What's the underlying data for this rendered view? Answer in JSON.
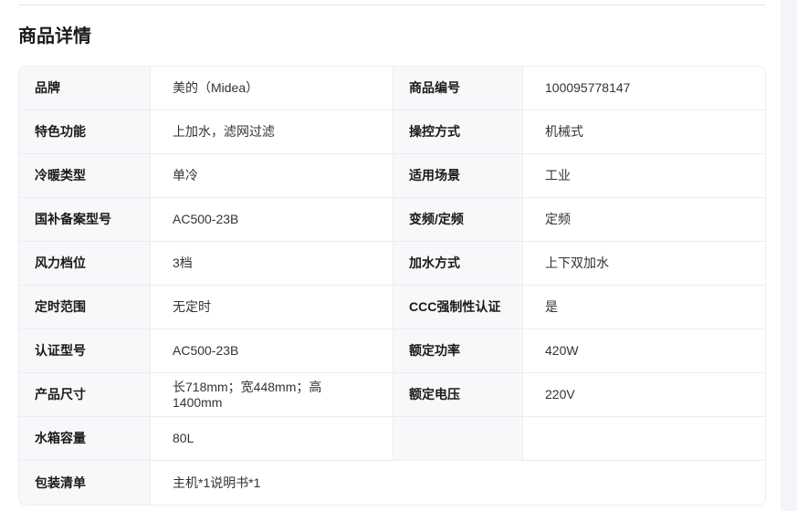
{
  "section_title": "商品详情",
  "rows": [
    {
      "label1": "品牌",
      "value1": "美的（Midea）",
      "label2": "商品编号",
      "value2": "100095778147"
    },
    {
      "label1": "特色功能",
      "value1": "上加水，滤网过滤",
      "label2": "操控方式",
      "value2": "机械式"
    },
    {
      "label1": "冷暖类型",
      "value1": "单冷",
      "label2": "适用场景",
      "value2": "工业"
    },
    {
      "label1": "国补备案型号",
      "value1": "AC500-23B",
      "label2": "变频/定频",
      "value2": "定频"
    },
    {
      "label1": "风力档位",
      "value1": "3档",
      "label2": "加水方式",
      "value2": "上下双加水"
    },
    {
      "label1": "定时范围",
      "value1": "无定时",
      "label2": "CCC强制性认证",
      "value2": "是"
    },
    {
      "label1": "认证型号",
      "value1": "AC500-23B",
      "label2": "额定功率",
      "value2": "420W"
    },
    {
      "label1": "产品尺寸",
      "value1": "长718mm；宽448mm；高1400mm",
      "label2": "额定电压",
      "value2": "220V"
    },
    {
      "label1": "水箱容量",
      "value1": "80L",
      "label2": "",
      "value2": ""
    },
    {
      "label1": "包装清单",
      "value1": "主机*1说明书*1"
    }
  ]
}
